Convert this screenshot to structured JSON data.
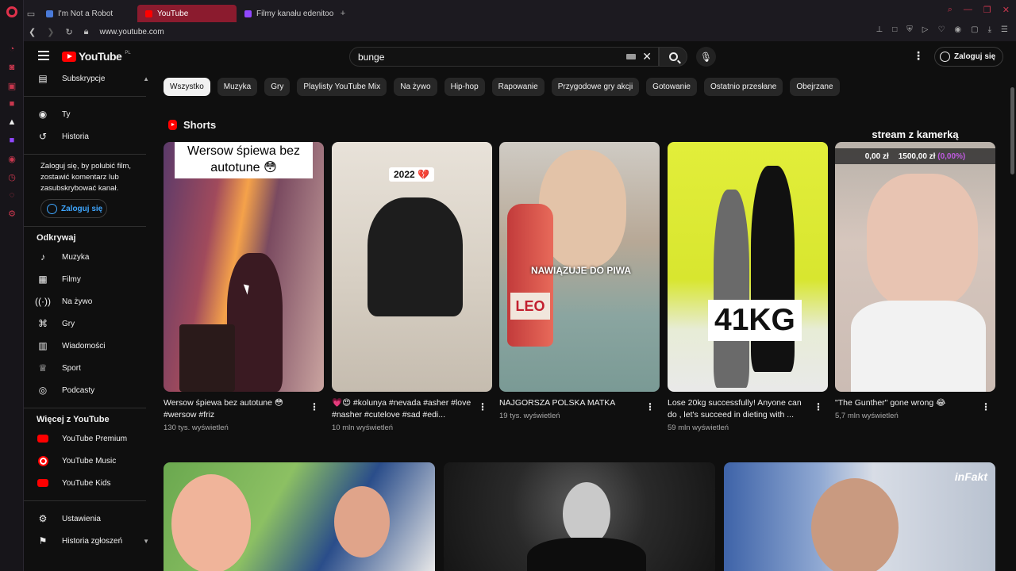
{
  "browser": {
    "tabs": [
      {
        "label": "I'm Not a Robot",
        "active": false
      },
      {
        "label": "YouTube",
        "active": true
      },
      {
        "label": "Filmy kanału edenitoo - Tw",
        "active": false
      }
    ],
    "new_tab": "+",
    "url": "www.youtube.com",
    "accent": "#e0314b"
  },
  "header": {
    "logo_text": "YouTube",
    "logo_region": "PL",
    "search_value": "bunge",
    "signin_label": "Zaloguj się"
  },
  "sidebar": {
    "subscriptions": "Subskrypcje",
    "you": "Ty",
    "history": "Historia",
    "signin_note": "Zaloguj się, by polubić film, zostawić komentarz lub zasubskrybować kanał.",
    "signin_label": "Zaloguj się",
    "explore_heading": "Odkrywaj",
    "explore": [
      "Muzyka",
      "Filmy",
      "Na żywo",
      "Gry",
      "Wiadomości",
      "Sport",
      "Podcasty"
    ],
    "more_heading": "Więcej z YouTube",
    "more": [
      "YouTube Premium",
      "YouTube Music",
      "YouTube Kids"
    ],
    "settings": "Ustawienia",
    "report_history": "Historia zgłoszeń"
  },
  "chips": [
    "Wszystko",
    "Muzyka",
    "Gry",
    "Playlisty YouTube Mix",
    "Na żywo",
    "Hip-hop",
    "Rapowanie",
    "Przygodowe gry akcji",
    "Gotowanie",
    "Ostatnio przesłane",
    "Obejrzane"
  ],
  "shorts": {
    "heading": "Shorts",
    "items": [
      {
        "title": "Wersow śpiewa bez autotune 😳 #wersow #friz",
        "views": "130 tys. wyświetleń",
        "caption": "Wersow śpiewa bez autotune 😳"
      },
      {
        "title": "💗😍 #kolunya #nevada #asher #love #nasher #cutelove #sad #edi...",
        "views": "10 mln wyświetleń",
        "caption": "2022 💔"
      },
      {
        "title": "NAJGORSZA POLSKA MATKA",
        "views": "19 tys. wyświetleń",
        "caption": "NAWIĄZUJE DO PIWA",
        "label": "LEO"
      },
      {
        "title": "Lose 20kg successfully! Anyone can do , let's succeed in dieting with ...",
        "views": "59 mln wyświetleń",
        "caption": "41KG"
      },
      {
        "title": "\"The Gunther\" gone wrong 😂",
        "views": "5,7 mln wyświetleń",
        "caption": "stream z kamerką",
        "money_left": "0,00 zł",
        "money_right": "1500,00 zł",
        "money_pct": "(0,00%)"
      }
    ]
  },
  "videos": {
    "brand_overlay": "inFakt"
  }
}
